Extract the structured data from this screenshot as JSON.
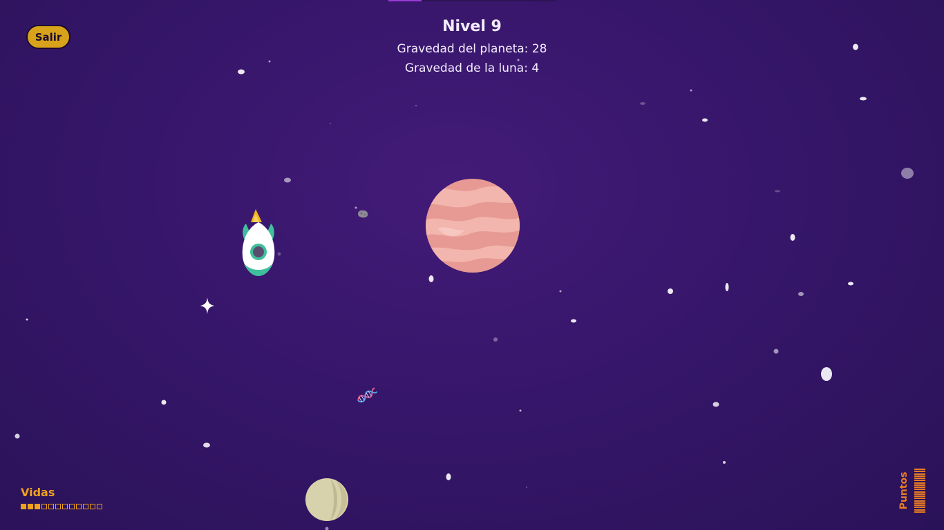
{
  "hud": {
    "exit_label": "Salir",
    "level_title": "Nivel 9",
    "planet_gravity": "Gravedad del planeta: 28",
    "moon_gravity": "Gravedad de la luna: 4",
    "level_progress": 0.2
  },
  "lives": {
    "label": "Vidas",
    "filled": 3,
    "total": 12
  },
  "points": {
    "label": "Puntos",
    "bars": 20
  },
  "colors": {
    "accent": "#f0a21a",
    "points": "#e87c25",
    "button": "#d8a31a"
  },
  "icons": {
    "ship": "rocket-icon",
    "planet": "planet-icon",
    "moon": "moon-icon",
    "asteroid": "asteroid-icon",
    "star": "sparkle-star-icon",
    "bonus": "dna-icon"
  }
}
